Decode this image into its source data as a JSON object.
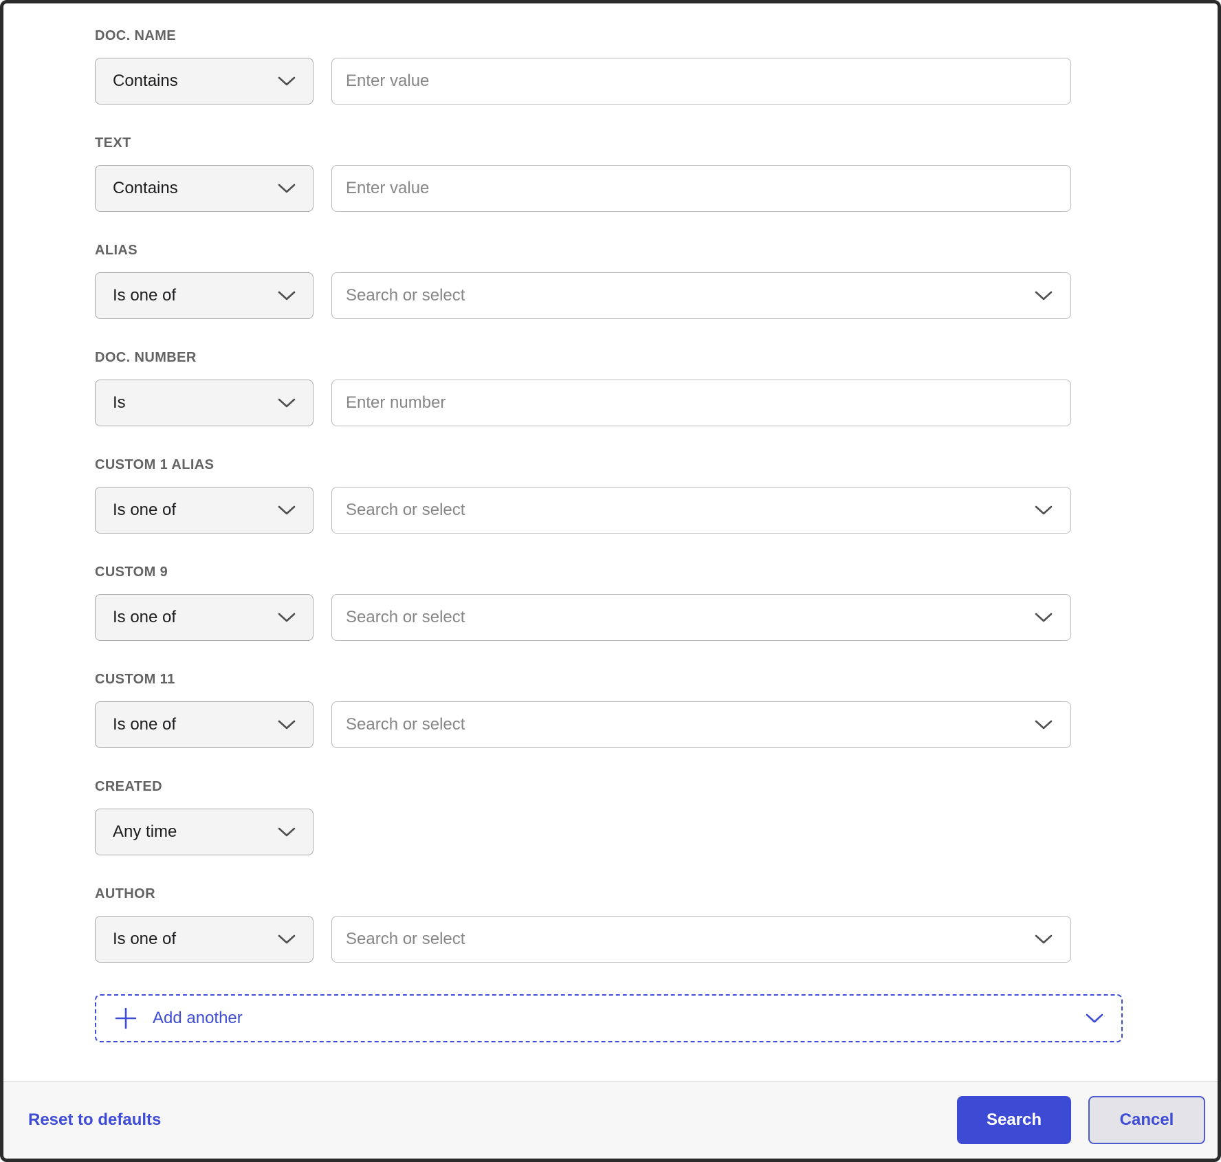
{
  "accent_color": "#3e4cd6",
  "rows": [
    {
      "label": "DOC. NAME",
      "operator": "Contains",
      "value_type": "text",
      "placeholder": "Enter value"
    },
    {
      "label": "TEXT",
      "operator": "Contains",
      "value_type": "text",
      "placeholder": "Enter value"
    },
    {
      "label": "ALIAS",
      "operator": "Is one of",
      "value_type": "select",
      "placeholder": "Search or select"
    },
    {
      "label": "DOC. NUMBER",
      "operator": "Is",
      "value_type": "number",
      "placeholder": "Enter number"
    },
    {
      "label": "CUSTOM 1 ALIAS",
      "operator": "Is one of",
      "value_type": "select",
      "placeholder": "Search or select"
    },
    {
      "label": "CUSTOM 9",
      "operator": "Is one of",
      "value_type": "select",
      "placeholder": "Search or select"
    },
    {
      "label": "CUSTOM 11",
      "operator": "Is one of",
      "value_type": "select",
      "placeholder": "Search or select"
    },
    {
      "label": "CREATED",
      "operator": "Any time",
      "value_type": "none",
      "placeholder": ""
    },
    {
      "label": "AUTHOR",
      "operator": "Is one of",
      "value_type": "select",
      "placeholder": "Search or select"
    }
  ],
  "add_another": {
    "label": "Add another"
  },
  "footer": {
    "reset_label": "Reset to defaults",
    "search_label": "Search",
    "cancel_label": "Cancel"
  }
}
